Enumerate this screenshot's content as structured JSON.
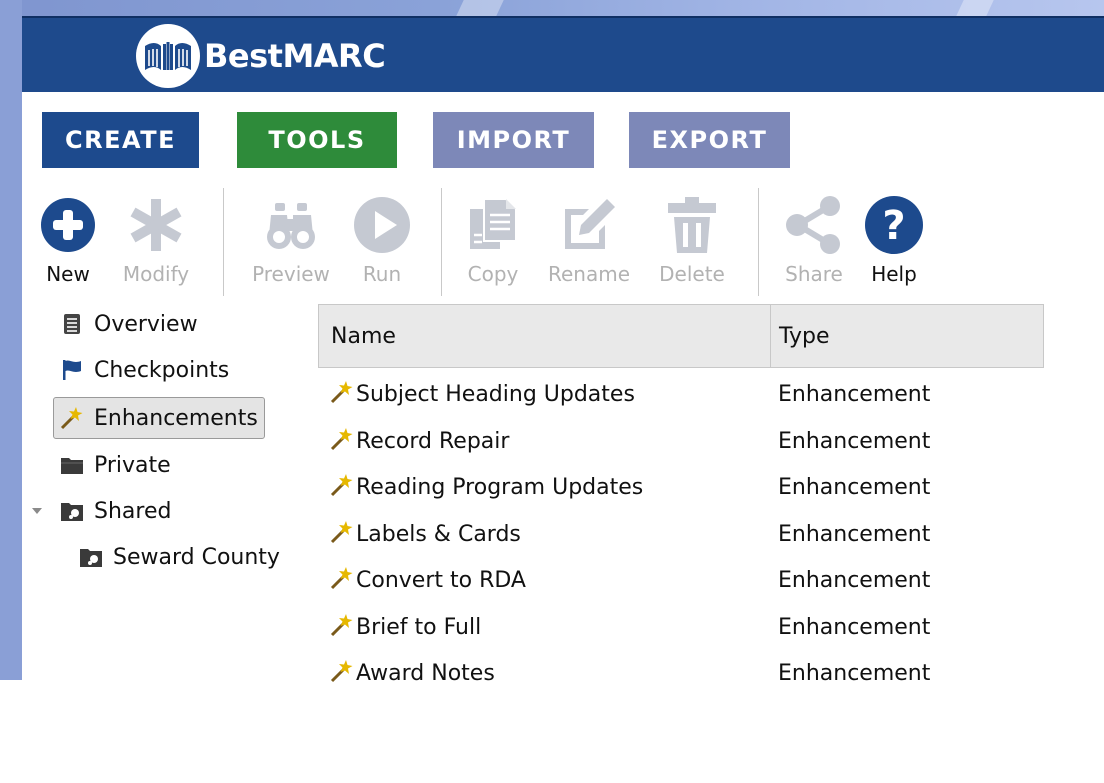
{
  "brand": {
    "name": "BestMARC",
    "header_color": "#1e4a8c"
  },
  "nav": {
    "tabs": [
      {
        "label": "CREATE",
        "color": "#1d4a8d"
      },
      {
        "label": "TOOLS",
        "color": "#2e8b3a"
      },
      {
        "label": "IMPORT",
        "color": "#7d88b8"
      },
      {
        "label": "EXPORT",
        "color": "#7d88b8"
      }
    ],
    "active_tab": "TOOLS"
  },
  "toolbar": {
    "new_label": "New",
    "modify_label": "Modify",
    "preview_label": "Preview",
    "run_label": "Run",
    "copy_label": "Copy",
    "rename_label": "Rename",
    "delete_label": "Delete",
    "share_label": "Share",
    "help_label": "Help",
    "enabled_color": "#1d4a8d",
    "disabled_color": "#c5c9d2"
  },
  "sidebar": {
    "items": [
      {
        "label": "Overview",
        "icon": "document-icon"
      },
      {
        "label": "Checkpoints",
        "icon": "flag-icon"
      },
      {
        "label": "Enhancements",
        "icon": "magic-wand-icon",
        "selected": true
      },
      {
        "label": "Private",
        "icon": "folder-icon"
      },
      {
        "label": "Shared",
        "icon": "shared-folder-icon",
        "expanded": true
      },
      {
        "label": "Seward County",
        "icon": "shared-folder-icon"
      }
    ]
  },
  "grid": {
    "columns": [
      "Name",
      "Type"
    ],
    "rows": [
      {
        "name": "Subject Heading Updates",
        "type": "Enhancement"
      },
      {
        "name": "Record Repair",
        "type": "Enhancement"
      },
      {
        "name": "Reading Program Updates",
        "type": "Enhancement"
      },
      {
        "name": "Labels & Cards",
        "type": "Enhancement"
      },
      {
        "name": "Convert to RDA",
        "type": "Enhancement"
      },
      {
        "name": "Brief to Full",
        "type": "Enhancement"
      },
      {
        "name": "Award Notes",
        "type": "Enhancement"
      }
    ]
  }
}
